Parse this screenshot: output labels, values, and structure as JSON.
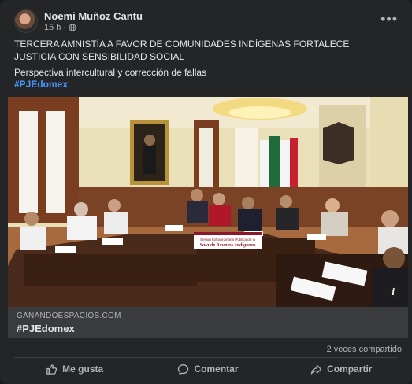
{
  "post": {
    "author": "Noemi Muñoz Cantu",
    "time": "15 h",
    "separator": "·",
    "more_label": "•••",
    "text": "TERCERA AMNISTÍA A FAVOR DE COMUNIDADES INDÍGENAS FORTALECE JUSTICIA CON SENSIBILIDAD SOCIAL",
    "subtitle": "Perspectiva intercultural y corrección de fallas",
    "hashtag": "#PJEdomex"
  },
  "photo": {
    "info_label": "i",
    "banner_line1": "Sesión Extraordinaria Pública de la",
    "banner_line2": "Sala de Asuntos Indígenas"
  },
  "link": {
    "domain": "GANANDOESPACIOS.COM",
    "title": "#PJEdomex"
  },
  "stats": {
    "shares": "2 veces compartido"
  },
  "actions": {
    "like": "Me gusta",
    "comment": "Comentar",
    "share": "Compartir"
  },
  "colors": {
    "background": "#242526",
    "text": "#e4e6eb",
    "secondary": "#b0b3b8",
    "link": "#4599ff",
    "link_box": "#3a3b3c"
  },
  "icons": [
    "globe-icon",
    "more-icon",
    "info-icon",
    "like-icon",
    "comment-icon",
    "share-icon"
  ]
}
